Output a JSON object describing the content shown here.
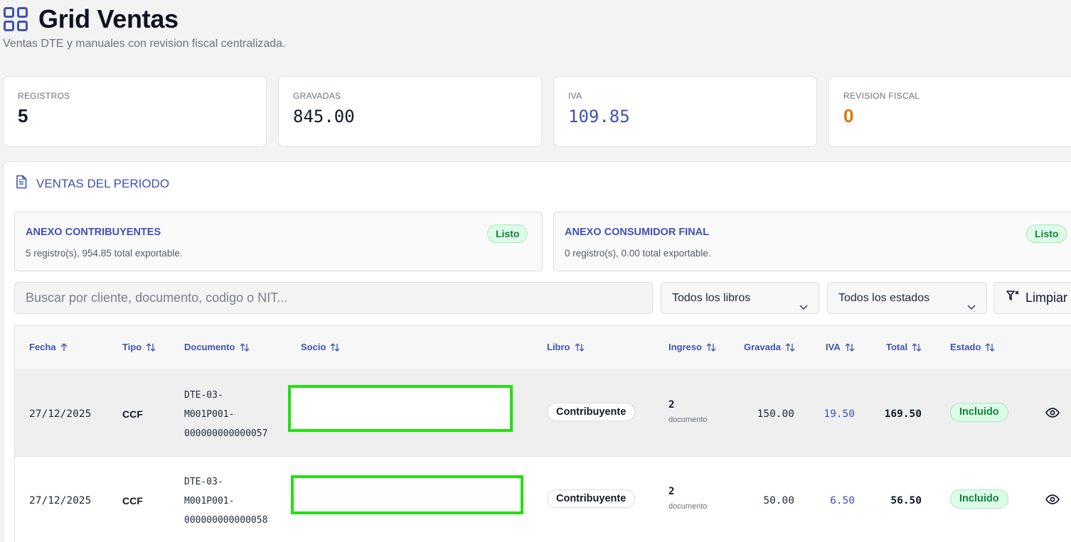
{
  "header": {
    "title": "Grid Ventas",
    "subtitle": "Ventas DTE y manuales con revision fiscal centralizada."
  },
  "stats": [
    {
      "label": "REGISTROS",
      "value": "5",
      "color": "#111827"
    },
    {
      "label": "GRAVADAS",
      "value": "845.00",
      "color": "#111827"
    },
    {
      "label": "IVA",
      "value": "109.85",
      "color": "#3f51b5"
    },
    {
      "label": "REVISION FISCAL",
      "value": "0",
      "color": "#d97706"
    }
  ],
  "panel": {
    "title": "VENTAS DEL PERIODO",
    "annexes": [
      {
        "title": "ANEXO CONTRIBUYENTES",
        "subtitle": "5 registro(s), 954.85 total exportable.",
        "badge": "Listo"
      },
      {
        "title": "ANEXO CONSUMIDOR FINAL",
        "subtitle": "0 registro(s), 0.00 total exportable.",
        "badge": "Listo"
      }
    ],
    "search_placeholder": "Buscar por cliente, documento, codigo o NIT...",
    "filters": {
      "libros": "Todos los libros",
      "estados": "Todos los estados",
      "clear": "Limpiar"
    }
  },
  "table": {
    "headers": {
      "fecha": "Fecha",
      "tipo": "Tipo",
      "documento": "Documento",
      "socio": "Socio",
      "libro": "Libro",
      "ingreso": "Ingreso",
      "gravada": "Gravada",
      "iva": "IVA",
      "total": "Total",
      "estado": "Estado"
    },
    "rows": [
      {
        "fecha": "27/12/2025",
        "tipo": "CCF",
        "doc_line1": "DTE-03-",
        "doc_line2": "M001P001-",
        "doc_line3": "000000000000057",
        "libro": "Contribuyente",
        "ingreso_num": "2",
        "ingreso_sub": "documento",
        "gravada": "150.00",
        "iva": "19.50",
        "total": "169.50",
        "estado": "Incluido"
      },
      {
        "fecha": "27/12/2025",
        "tipo": "CCF",
        "doc_line1": "DTE-03-",
        "doc_line2": "M001P001-",
        "doc_line3": "000000000000058",
        "libro": "Contribuyente",
        "ingreso_num": "2",
        "ingreso_sub": "documento",
        "gravada": "50.00",
        "iva": "6.50",
        "total": "56.50",
        "estado": "Incluido"
      }
    ]
  },
  "icons": {
    "grid": "grid-icon",
    "document": "document-icon",
    "sort": "sort-icon",
    "chevron": "chevron-down-icon",
    "filter": "filter-clear-icon",
    "view": "eye-icon"
  }
}
